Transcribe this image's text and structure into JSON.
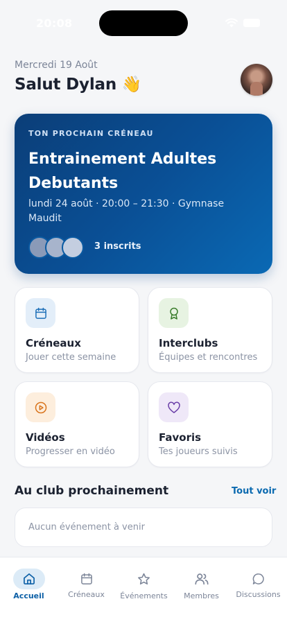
{
  "status_bar": {
    "time": "20:08"
  },
  "header": {
    "date": "Mercredi 19 Août",
    "greeting": "Salut Dylan 👋"
  },
  "next_slot": {
    "kicker": "TON PROCHAIN CRÉNEAU",
    "title": "Entrainement Adultes Debutants",
    "details": "lundi 24 août · 20:00 – 21:30 · Gymnase Maudit",
    "registered": "3 inscrits"
  },
  "tiles": [
    {
      "title": "Créneaux",
      "subtitle": "Jouer cette semaine",
      "icon": "calendar-icon",
      "bg": "#e3eef9",
      "color": "#1d6fb8"
    },
    {
      "title": "Interclubs",
      "subtitle": "Équipes et rencontres",
      "icon": "award-icon",
      "bg": "#e7f3e2",
      "color": "#3a7d2c"
    },
    {
      "title": "Vidéos",
      "subtitle": "Progresser en vidéo",
      "icon": "play-circle-icon",
      "bg": "#fdeedd",
      "color": "#d9741c"
    },
    {
      "title": "Favoris",
      "subtitle": "Tes joueurs suivis",
      "icon": "heart-icon",
      "bg": "#efe8f8",
      "color": "#6b3fa8"
    }
  ],
  "upcoming": {
    "title": "Au club prochainement",
    "link": "Tout voir",
    "empty": "Aucun événement à venir"
  },
  "tab_bar": {
    "items": [
      {
        "label": "Accueil",
        "icon": "home-icon",
        "active": true
      },
      {
        "label": "Créneaux",
        "icon": "calendar-icon",
        "active": false
      },
      {
        "label": "Événements",
        "icon": "star-icon",
        "active": false
      },
      {
        "label": "Membres",
        "icon": "users-icon",
        "active": false
      },
      {
        "label": "Discussions",
        "icon": "chat-icon",
        "active": false
      }
    ],
    "active_color": "#0b5fa6",
    "inactive_color": "#7c8598"
  }
}
